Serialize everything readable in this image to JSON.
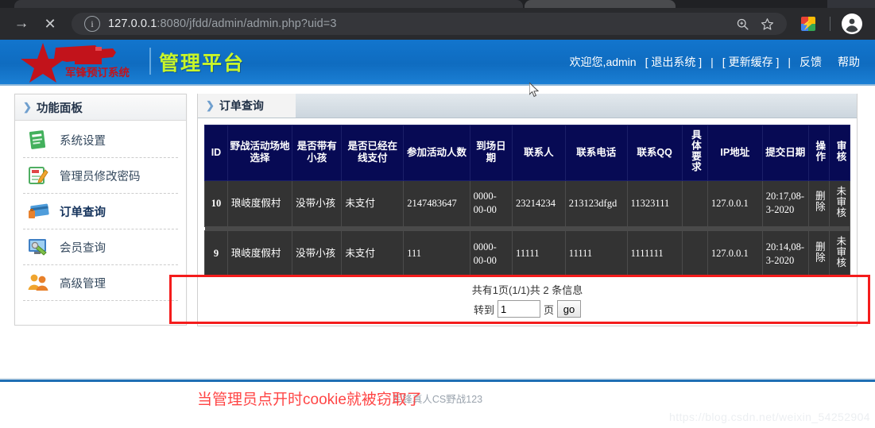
{
  "browser": {
    "url_host": "127.0.0.1",
    "url_rest": ":8080/jfdd/admin/admin.php?uid=3",
    "back_icon": "back-arrow-icon",
    "forward_icon": "forward-arrow-icon",
    "stop_icon": "stop-x-icon",
    "info_icon": "site-info-icon",
    "zoom_icon": "zoom-magnifier-icon",
    "bookmark_icon": "star-bookmark-icon",
    "extension_icon": "extension-icon",
    "profile_icon": "profile-avatar-icon"
  },
  "header": {
    "logo_text": "军锋预订系统",
    "platform_title": "管理平台",
    "welcome": "欢迎您,admin",
    "logout": "[ 退出系统 ]",
    "sep": "|",
    "refresh_cache": "[ 更新缓存 ]",
    "feedback": "反馈",
    "help": "帮助"
  },
  "sidebar": {
    "title": "功能面板",
    "items": [
      {
        "label": "系统设置",
        "icon": "system-settings-icon",
        "active": false
      },
      {
        "label": "管理员修改密码",
        "icon": "edit-password-icon",
        "active": false
      },
      {
        "label": "订单查询",
        "icon": "order-query-icon",
        "active": true
      },
      {
        "label": "会员查询",
        "icon": "member-query-icon",
        "active": false
      },
      {
        "label": "高级管理",
        "icon": "advanced-manage-icon",
        "active": false
      }
    ]
  },
  "content": {
    "tab_label": "订单查询",
    "table": {
      "columns": [
        "ID",
        "野战活动场地选择",
        "是否带有小孩",
        "是否已经在线支付",
        "参加活动人数",
        "到场日期",
        "联系人",
        "联系电话",
        "联系QQ",
        "具体要求",
        "IP地址",
        "提交日期",
        "操作",
        "审核"
      ],
      "rows": [
        {
          "id": "10",
          "venue": "琅岐度假村",
          "children": "没带小孩",
          "paid": "未支付",
          "people": "2147483647",
          "arrive_date": "0000-00-00",
          "contact": "23214234",
          "phone": "213123dfgd",
          "qq": "11323111",
          "requirement": "",
          "ip": "127.0.0.1",
          "submit_date": "20:17,08-3-2020",
          "action": "删除",
          "audit": "未审核"
        },
        {
          "id": "9",
          "venue": "琅岐度假村",
          "children": "没带小孩",
          "paid": "未支付",
          "people": "111",
          "arrive_date": "0000-00-00",
          "contact": "11111",
          "phone": "11111",
          "qq": "1111111",
          "requirement": "",
          "ip": "127.0.0.1",
          "submit_date": "20:14,08-3-2020",
          "action": "删除",
          "audit": "未审核"
        }
      ]
    },
    "pager": {
      "summary": "共有1页(1/1)共 2  条信息",
      "goto_label": "转到",
      "page_value": "1",
      "page_unit": "页",
      "go_label": "go"
    }
  },
  "footer": {
    "text": "军锋真人CS野战123",
    "watermark": "https://blog.csdn.net/weixin_54252904"
  },
  "annotation": {
    "note": "当管理员点开时cookie就被窃取了",
    "box_color": "#f41c1c",
    "note_color": "#ff4545"
  }
}
